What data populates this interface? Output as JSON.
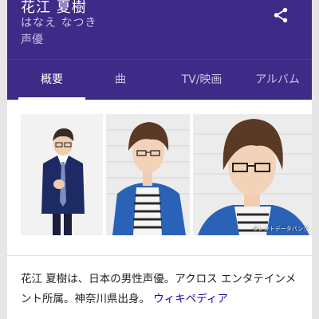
{
  "header": {
    "name": "花江 夏樹",
    "reading": "はなえ なつき",
    "occupation": "声優"
  },
  "icons": {
    "share": "share-icon"
  },
  "tabs": [
    {
      "label": "概要",
      "active": true
    },
    {
      "label": "曲",
      "active": false
    },
    {
      "label": "TV/映画",
      "active": false
    },
    {
      "label": "アルバム",
      "active": false
    }
  ],
  "photos": {
    "watermark": "タレントデータバンク"
  },
  "description": {
    "text": "花江 夏樹は、日本の男性声優。アクロス エンタテインメント所属。神奈川県出身。",
    "link": "ウィキペディア"
  },
  "colors": {
    "header_bg": "#3e2a87",
    "tab_active": "#ffffff",
    "tab_inactive": "#c9c3e4",
    "link": "#1a0dab"
  }
}
